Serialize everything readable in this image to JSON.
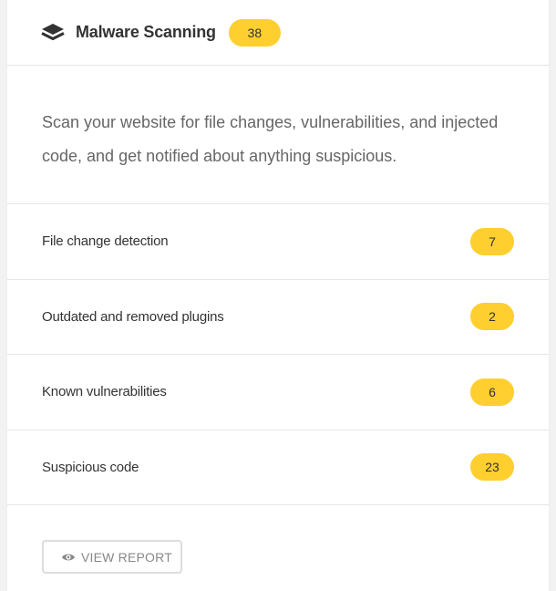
{
  "header": {
    "icon": "layers-icon",
    "title": "Malware Scanning",
    "count": "38"
  },
  "description": "Scan your website for file changes, vulnerabilities, and injected code, and get notified about anything suspicious.",
  "rows": [
    {
      "label": "File change detection",
      "count": "7"
    },
    {
      "label": "Outdated and removed plugins",
      "count": "2"
    },
    {
      "label": "Known vulnerabilities",
      "count": "6"
    },
    {
      "label": "Suspicious code",
      "count": "23"
    }
  ],
  "footer": {
    "button_icon": "eye-icon",
    "button_label": "VIEW REPORT"
  },
  "colors": {
    "badge": "#fecf2f",
    "text": "#333333",
    "muted": "#666666"
  }
}
